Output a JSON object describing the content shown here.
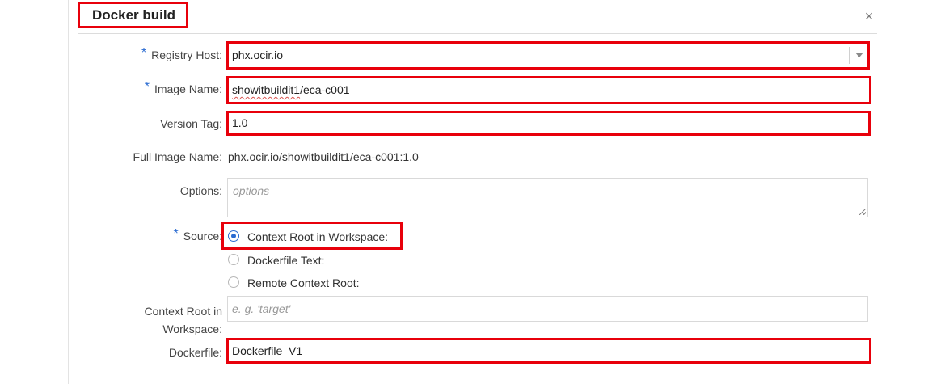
{
  "dialog": {
    "title": "Docker build",
    "close_glyph": "×"
  },
  "form": {
    "required_marker": "*",
    "registry_host": {
      "label": "Registry Host:",
      "value": "phx.ocir.io"
    },
    "image_name": {
      "label": "Image Name:",
      "value_underlined": "showitbuildit1",
      "value_rest": "/eca-c001"
    },
    "version_tag": {
      "label": "Version Tag:",
      "value": "1.0"
    },
    "full_image_name": {
      "label": "Full Image Name:",
      "value": "phx.ocir.io/showitbuildit1/eca-c001:1.0"
    },
    "options": {
      "label": "Options:",
      "placeholder": "options"
    },
    "source": {
      "label": "Source:",
      "options": [
        {
          "label": "Context Root in Workspace:",
          "selected": true
        },
        {
          "label": "Dockerfile Text:",
          "selected": false
        },
        {
          "label": "Remote Context Root:",
          "selected": false
        }
      ]
    },
    "context_root": {
      "label_line1": "Context Root in",
      "label_line2": "Workspace:",
      "placeholder": "e. g. 'target'"
    },
    "dockerfile": {
      "label": "Dockerfile:",
      "value": "Dockerfile_V1"
    }
  },
  "icons": {
    "close": "close-icon",
    "dropdown": "chevron-down-icon",
    "resize": "resize-handle-icon"
  },
  "colors": {
    "highlight": "#e8000b",
    "required": "#2a6bd1",
    "radio_selected": "#2a6bd1"
  }
}
